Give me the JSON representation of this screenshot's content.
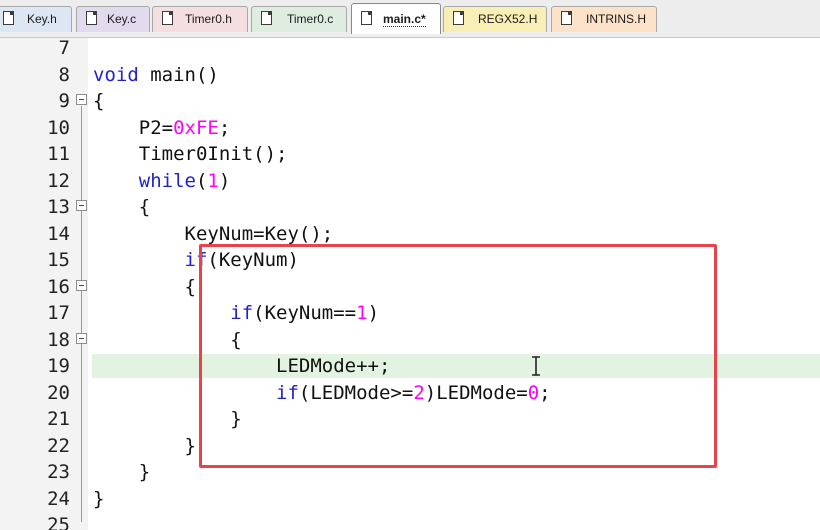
{
  "tabs": [
    {
      "label": "Key.h"
    },
    {
      "label": "Key.c"
    },
    {
      "label": "Timer0.h"
    },
    {
      "label": "Timer0.c"
    },
    {
      "label": "main.c*"
    },
    {
      "label": "REGX52.H"
    },
    {
      "label": "INTRINS.H"
    }
  ],
  "editor": {
    "current_line": "19",
    "lines": [
      {
        "num": "7",
        "code": ""
      },
      {
        "num": "8",
        "code": "void main()"
      },
      {
        "num": "9",
        "code": "{"
      },
      {
        "num": "10",
        "code": "    P2=0xFE;"
      },
      {
        "num": "11",
        "code": "    Timer0Init();"
      },
      {
        "num": "12",
        "code": "    while(1)"
      },
      {
        "num": "13",
        "code": "    {"
      },
      {
        "num": "14",
        "code": "        KeyNum=Key();"
      },
      {
        "num": "15",
        "code": "        if(KeyNum)"
      },
      {
        "num": "16",
        "code": "        {"
      },
      {
        "num": "17",
        "code": "            if(KeyNum==1)"
      },
      {
        "num": "18",
        "code": "            {"
      },
      {
        "num": "19",
        "code": "                LEDMode++;"
      },
      {
        "num": "20",
        "code": "                if(LEDMode>=2)LEDMode=0;"
      },
      {
        "num": "21",
        "code": "            }"
      },
      {
        "num": "22",
        "code": "        }"
      },
      {
        "num": "23",
        "code": "    }"
      },
      {
        "num": "24",
        "code": "}"
      },
      {
        "num": "25",
        "code": ""
      }
    ]
  },
  "colors": {
    "keyword": "#1f23c9",
    "number": "#ff00ff",
    "current_line_highlight": "#e2f3e2",
    "annotation_box": "#e8434b"
  }
}
